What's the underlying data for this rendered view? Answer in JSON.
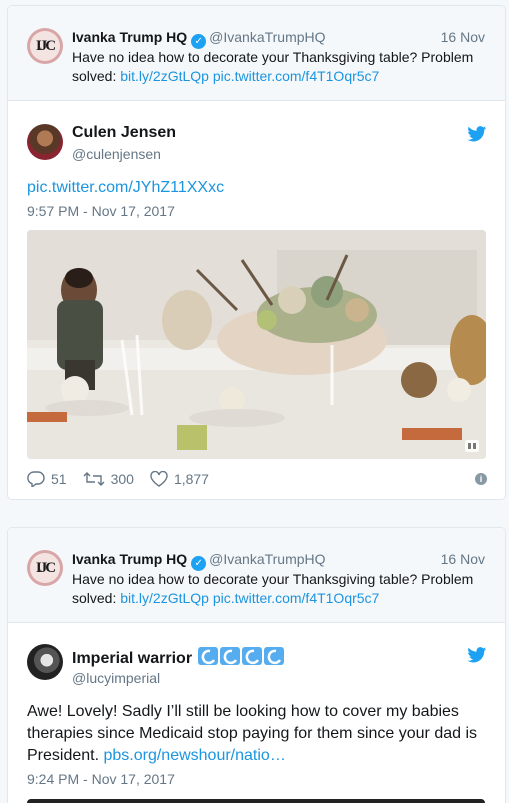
{
  "tweets": [
    {
      "quoted": {
        "logo_text": "IJC",
        "name": "Ivanka Trump HQ",
        "handle": "@IvankaTrumpHQ",
        "date": "16 Nov",
        "text": "Have no idea how to decorate your Thanksgiving table? Problem solved: ",
        "link1": "bit.ly/2zGtLQp",
        "link2": "pic.twitter.com/f4T1Oqr5c7"
      },
      "author": {
        "name": "Culen Jensen",
        "handle": "@culenjensen"
      },
      "link_text": "pic.twitter.com/JYhZ11XXxc",
      "timestamp": "9:57 PM - Nov 17, 2017",
      "replies": "51",
      "retweets": "300",
      "likes": "1,877"
    },
    {
      "quoted": {
        "logo_text": "IJC",
        "name": "Ivanka Trump HQ",
        "handle": "@IvankaTrumpHQ",
        "date": "16 Nov",
        "text": "Have no idea how to decorate your Thanksgiving table? Problem solved: ",
        "link1": "bit.ly/2zGtLQp",
        "link2": "pic.twitter.com/f4T1Oqr5c7"
      },
      "author": {
        "name": "Imperial warrior",
        "handle": "@lucyimperial"
      },
      "text": "Awe! Lovely! Sadly I’ll still be looking how to cover my babies therapies since Medicaid stop paying for them since your dad is President. ",
      "link_text": "pbs.org/newshour/natio…",
      "timestamp": "9:24 PM - Nov 17, 2017"
    }
  ],
  "colors": {
    "link": "#1b95e0",
    "verified": "#1da1f2",
    "muted": "#657786"
  },
  "icons": [
    "twitter-bird-icon",
    "verified-badge-icon",
    "reply-icon",
    "retweet-icon",
    "heart-icon",
    "info-icon",
    "wave-emoji-icon"
  ]
}
